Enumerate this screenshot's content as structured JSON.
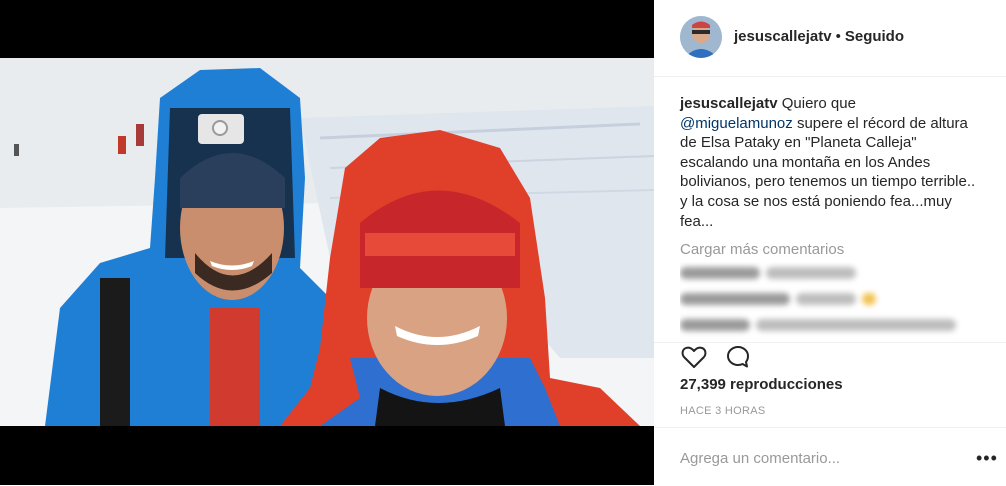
{
  "header": {
    "username": "jesuscallejatv",
    "separator": "•",
    "follow_status": "Seguido"
  },
  "caption": {
    "username": "jesuscallejatv",
    "text_before_mention": " Quiero que ",
    "mention": "@miguelamunoz",
    "text_after_mention": " supere el récord de altura de Elsa Pataky en \"Planeta Calleja\" escalando una montaña en los Andes bolivianos, pero tenemos un tiempo terrible.. y la cosa se nos está poniendo fea...muy fea..."
  },
  "load_more": "Cargar más comentarios",
  "views": "27,399 reproducciones",
  "time": "HACE 3 HORAS",
  "comment_input": {
    "placeholder": "Agrega un comentario..."
  },
  "icons": {
    "like": "heart-icon",
    "comment": "comment-icon",
    "more": "more-options-icon"
  },
  "colors": {
    "text": "#262626",
    "muted": "#999999",
    "mention": "#003569",
    "divider": "#efefef"
  }
}
